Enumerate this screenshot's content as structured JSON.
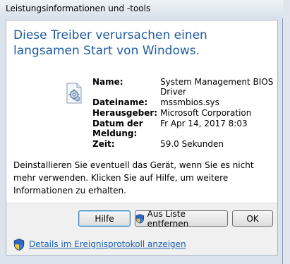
{
  "window": {
    "title": "Leistungsinformationen und -tools"
  },
  "dialog": {
    "headline": "Diese Treiber verursachen einen langsamen Start von Windows.",
    "icon": "driver-file-icon",
    "details": [
      {
        "label": "Name:",
        "value": "System Management BIOS Driver"
      },
      {
        "label": "Dateiname:",
        "value": "mssmbios.sys"
      },
      {
        "label": "Herausgeber:",
        "value": "Microsoft Corporation"
      },
      {
        "label": "Datum der Meldung:",
        "value": "Fr Apr 14, 2017 8:03"
      },
      {
        "label": "Zeit:",
        "value": "59.0 Sekunden"
      }
    ],
    "message": "Deinstallieren Sie eventuell das Gerät, wenn Sie es nicht mehr verwenden. Klicken Sie auf Hilfe, um weitere Informationen zu erhalten.",
    "buttons": {
      "help": "Hilfe",
      "remove": "Aus Liste entfernen",
      "ok": "OK"
    },
    "footer_link": "Details im Ereignisprotokoll anzeigen"
  },
  "colors": {
    "headline": "#1e5aa0",
    "link": "#1a5fb4"
  }
}
